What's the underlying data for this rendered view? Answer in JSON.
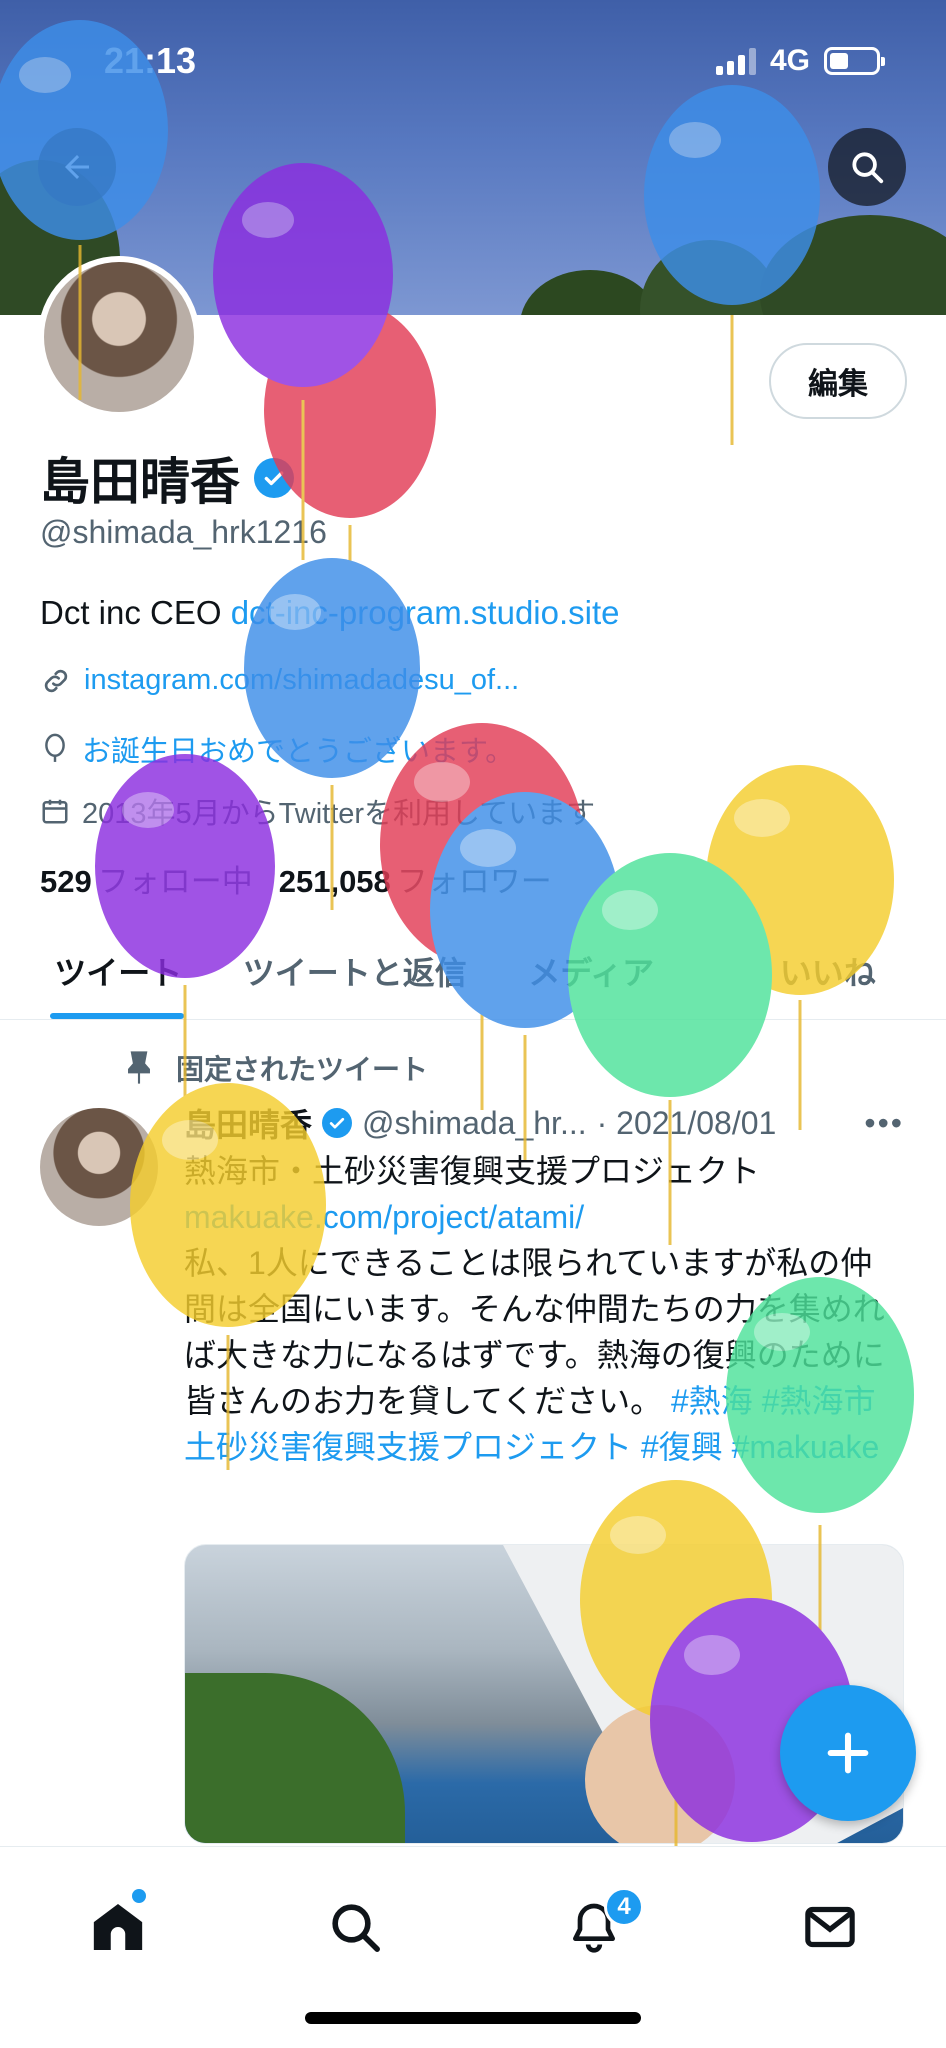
{
  "status_bar": {
    "time": "21:13",
    "network": "4G"
  },
  "header": {
    "edit_label": "編集"
  },
  "profile": {
    "name": "島田晴香",
    "handle": "@shimada_hrk1216",
    "bio_text": "Dct inc CEO ",
    "bio_link": "dct-inc-program.studio.site",
    "website": "instagram.com/shimadadesu_of...",
    "birthday_text": "お誕生日おめでとうございます。",
    "joined_text": "2013年5月からTwitterを利用しています",
    "following_count": "529",
    "following_label": "フォロー中",
    "followers_count": "251,058",
    "followers_label": "フォロワー"
  },
  "tabs": [
    {
      "label": "ツイート",
      "active": true
    },
    {
      "label": "ツイートと返信",
      "active": false
    },
    {
      "label": "メディア",
      "active": false
    },
    {
      "label": "いいね",
      "active": false
    }
  ],
  "pinned_tweet": {
    "pinned_label": "固定されたツイート",
    "author_name": "島田晴香",
    "author_handle": "@shimada_hr...",
    "date": "· 2021/08/01",
    "more": "•••",
    "line1": "熱海市・土砂災害復興支援プロジェクト",
    "link": "makuake.com/project/atami/",
    "body": "私、1人にできることは限られていますが私の仲間は全国にいます。そんな仲間たちの力を集めれば大きな力になるはずです。熱海の復興のために皆さんのお力を貸してください。",
    "hashtag1": "#熱海",
    "hashtag2": "#熱海市土砂災害復興支援プロジェクト",
    "hashtag3": "#復興",
    "hashtag4": "#makuake"
  },
  "bottom_nav": {
    "items": [
      "home-icon",
      "search-icon",
      "bell-icon",
      "mail-icon"
    ],
    "notification_badge": "4"
  },
  "colors": {
    "accent": "#1d9bf0",
    "text": "#0f1419",
    "muted": "#536471"
  }
}
